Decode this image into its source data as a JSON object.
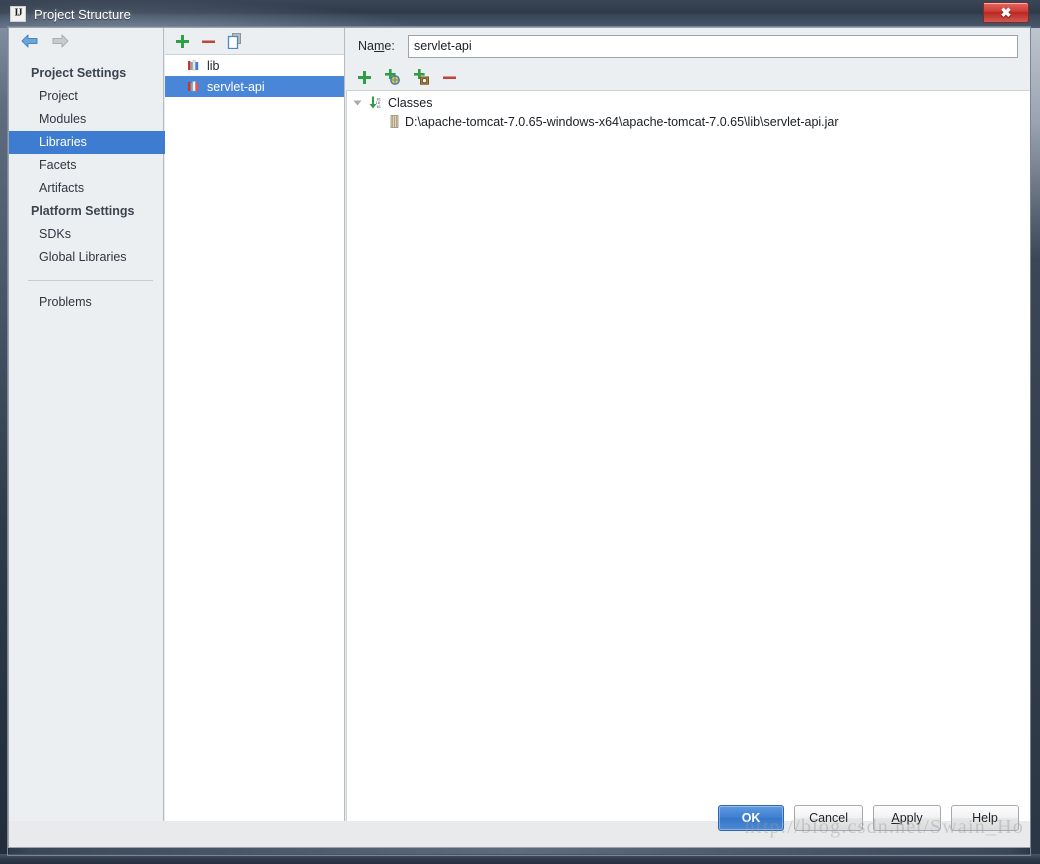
{
  "window": {
    "title": "Project Structure",
    "app_icon": "intellij-idea-icon",
    "close_icon": "close-icon"
  },
  "nav": {
    "back_icon": "arrow-left-icon",
    "forward_icon": "arrow-right-icon"
  },
  "sidebar": {
    "groups": [
      {
        "label": "Project Settings",
        "items": [
          {
            "label": "Project",
            "selected": false
          },
          {
            "label": "Modules",
            "selected": false
          },
          {
            "label": "Libraries",
            "selected": true
          },
          {
            "label": "Facets",
            "selected": false
          },
          {
            "label": "Artifacts",
            "selected": false
          }
        ]
      },
      {
        "label": "Platform Settings",
        "items": [
          {
            "label": "SDKs",
            "selected": false
          },
          {
            "label": "Global Libraries",
            "selected": false
          }
        ]
      }
    ],
    "footer_items": [
      {
        "label": "Problems",
        "selected": false
      }
    ]
  },
  "library_panel": {
    "toolbar": [
      {
        "name": "add-library-button",
        "icon": "plus-icon",
        "label": "+"
      },
      {
        "name": "remove-library-button",
        "icon": "minus-icon",
        "label": "−"
      },
      {
        "name": "copy-library-button",
        "icon": "copy-icon",
        "label": "copy"
      }
    ],
    "items": [
      {
        "label": "lib",
        "icon": "library-books-icon",
        "selected": false
      },
      {
        "label": "servlet-api",
        "icon": "library-books-icon",
        "selected": true
      }
    ]
  },
  "detail": {
    "name_label_before": "Na",
    "name_label_mnemonic": "m",
    "name_label_after": "e:",
    "name_value": "servlet-api",
    "name_placeholder": "",
    "roots_toolbar": [
      {
        "name": "add-root-button",
        "icon": "plus-icon"
      },
      {
        "name": "add-url-root-button",
        "icon": "plus-globe-icon"
      },
      {
        "name": "add-jar-directory-button",
        "icon": "plus-jar-icon"
      },
      {
        "name": "remove-root-button",
        "icon": "minus-icon"
      }
    ],
    "tree": {
      "root": {
        "label": "Classes",
        "icon": "classes-root-icon",
        "expanded": true,
        "toggle_icon": "triangle-down-icon"
      },
      "children": [
        {
          "label": "D:\\apache-tomcat-7.0.65-windows-x64\\apache-tomcat-7.0.65\\lib\\servlet-api.jar",
          "icon": "jar-file-icon"
        }
      ]
    }
  },
  "footer": {
    "buttons": [
      {
        "label": "OK",
        "default": true,
        "mnemonic": ""
      },
      {
        "label": "Cancel",
        "default": false,
        "mnemonic": ""
      },
      {
        "label": "Apply",
        "default": false,
        "mnemonic": "A"
      },
      {
        "label": "Help",
        "default": false,
        "mnemonic": ""
      }
    ]
  },
  "watermark": {
    "text": "http://blog.csdn.net/Swain_Ho"
  },
  "colors": {
    "selection_blue": "#4a86d8",
    "sidebar_selection_blue": "#3d7cd0",
    "default_button_blue": "#3f7fd2",
    "green_plus": "#2f9e44",
    "red_minus": "#c0453b",
    "titlebar_dark": "#2f3a49"
  }
}
